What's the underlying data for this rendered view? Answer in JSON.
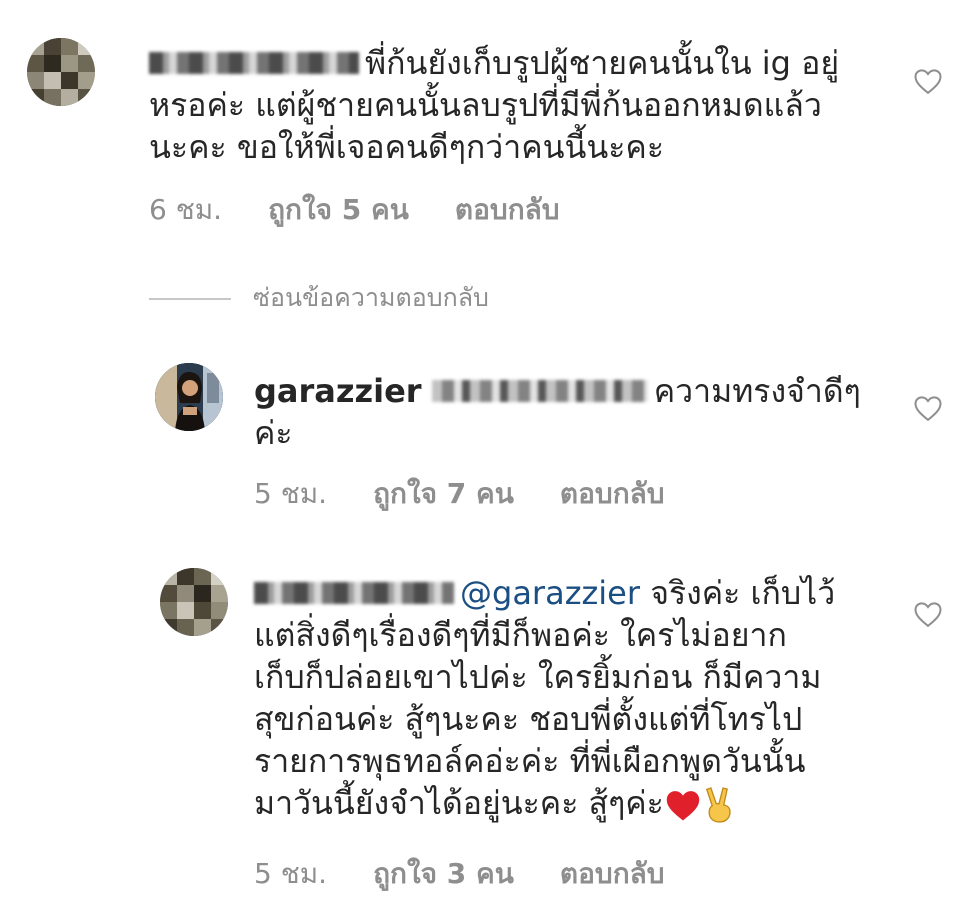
{
  "comments": [
    {
      "text": "พี่ก้นยังเก็บรูปผู้ชายคนนั้นใน ig อยู่หรอค่ะ แต่ผู้ชายคนนั้นลบรูปที่มีพี่ก้นออกหมดแล้วนะคะ ขอให้พี่เจอคนดีๆกว่าคนนี้นะคะ",
      "line1": "พี่ก้นยังเก็บรูปผู้ชายคนนั้นใน ig อยู่",
      "line2": "หรอค่ะ แต่ผู้ชายคนนั้นลบรูปที่มีพี่ก้นออกหมดแล้ว",
      "line3": "นะคะ ขอให้พี่เจอคนดีๆกว่าคนนี้นะคะ",
      "time": "6 ชม.",
      "likes": "ถูกใจ 5 คน",
      "reply": "ตอบกลับ",
      "like_icon": "heart-outline-icon"
    },
    {
      "username": "garazzier",
      "line1": "ความทรงจำดีๆ",
      "line2": "ค่ะ",
      "time": "5 ชม.",
      "likes": "ถูกใจ 7 คน",
      "reply": "ตอบกลับ",
      "like_icon": "heart-outline-icon"
    },
    {
      "mention": "@garazzier",
      "line1": "จริงค่ะ เก็บไว้",
      "line2": "แต่สิ่งดีๆเรื่องดีๆที่มีก็พอค่ะ ใครไม่อยาก",
      "line3": "เก็บก็ปล่อยเขาไปค่ะ ใครยิ้มก่อน ก็มีความ",
      "line4": "สุขก่อนค่ะ สู้ๆนะคะ ชอบพี่ตั้งแต่ที่โทรไป",
      "line5": "รายการพุธทอล์คอ่ะค่ะ ที่พี่เผือกพูดวันนั้น",
      "line6": "มาวันนี้ยังจำได้อยู่นะคะ สู้ๆค่ะ",
      "emojis": [
        "red-heart-emoji",
        "victory-hand-emoji"
      ],
      "time": "5 ชม.",
      "likes": "ถูกใจ 3 คน",
      "reply": "ตอบกลับ",
      "like_icon": "heart-outline-icon"
    }
  ],
  "hide_replies_label": "ซ่อนข้อความตอบกลับ"
}
